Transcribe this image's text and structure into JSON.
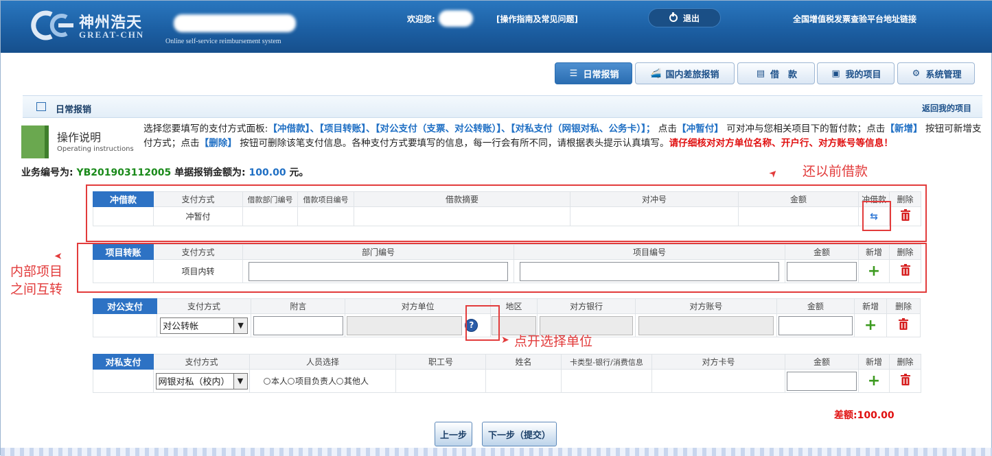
{
  "header": {
    "logo_cn": "神州浩天",
    "logo_en": "GREAT-CHN",
    "logo_tagline": "Online self-service reimbursement system",
    "welcome": "欢迎您:",
    "guide_link": "[操作指南及常见问题]",
    "logout": "退出",
    "verify_link": "全国增值税发票查验平台地址链接"
  },
  "nav": {
    "items": [
      {
        "label": "日常报销",
        "icon": "list-icon",
        "active": true
      },
      {
        "label": "国内差旅报销",
        "icon": "train-icon",
        "active": false
      },
      {
        "label": "借　款",
        "icon": "wallet-icon",
        "active": false
      },
      {
        "label": "我的项目",
        "icon": "window-icon",
        "active": false
      },
      {
        "label": "系统管理",
        "icon": "settings-icon",
        "active": false
      }
    ]
  },
  "section": {
    "title": "日常报销",
    "back_link": "返回我的项目"
  },
  "instructions": {
    "title": "操作说明",
    "subtitle": "Operating instructions",
    "p1": "选择您要填写的支付方式面板:",
    "b1": "【冲借款】、【项目转账】、【对公支付（支票、对公转账）】、【对私支付（网银对私、公务卡）】；",
    "p2": "点击",
    "b2": "【冲暂付】",
    "p3": "可对冲与您相关项目下的暂付款；点击",
    "b3": "【新增】",
    "p4": "按钮可新增支付方式；点击",
    "b4": "【删除】",
    "p5": "按钮可删除该笔支付信息。各种支付方式要填写的信息，每一行会有所不同，请根据表头提示认真填写。",
    "r1": "请仔细核对对方单位名称、开户行、对方账号等信息！"
  },
  "biz": {
    "no_label": "业务编号为:",
    "no_value": "YB201903112005",
    "amount_label": "单据报销金额为:",
    "amount_value": "100.00",
    "unit": "元。"
  },
  "panel_offset": {
    "label": "冲借款",
    "headers": [
      "支付方式",
      "借款部门编号",
      "借款项目编号",
      "借款摘要",
      "对冲号",
      "金额",
      "冲借款",
      "删除"
    ],
    "row_method": "冲暂付"
  },
  "panel_transfer": {
    "label": "项目转账",
    "headers": [
      "支付方式",
      "部门编号",
      "项目编号",
      "金额",
      "新增",
      "删除"
    ],
    "row_method": "项目内转"
  },
  "panel_public": {
    "label": "对公支付",
    "headers": [
      "支付方式",
      "附言",
      "对方单位",
      "地区",
      "对方银行",
      "对方账号",
      "金额",
      "新增",
      "删除"
    ],
    "select_value": "对公转帐"
  },
  "panel_private": {
    "label": "对私支付",
    "headers": [
      "支付方式",
      "人员选择",
      "职工号",
      "姓名",
      "卡类型-银行/消费信息",
      "对方卡号",
      "金额",
      "新增",
      "删除"
    ],
    "select_value": "网银对私（校内）",
    "radios": [
      "本人",
      "项目负责人",
      "其他人"
    ]
  },
  "annotations": {
    "repay": "还以前借款",
    "internal": "内部项目\n之间互转",
    "choose_unit": "点开选择单位"
  },
  "footer": {
    "diff": "差额:100.00",
    "prev": "上一步",
    "next": "下一步（提交）"
  },
  "colors": {
    "header_blue": "#1c5fa3",
    "label_blue": "#2d72c4",
    "annotation_red": "#e23b3b",
    "add_green": "#3c9a1f"
  }
}
